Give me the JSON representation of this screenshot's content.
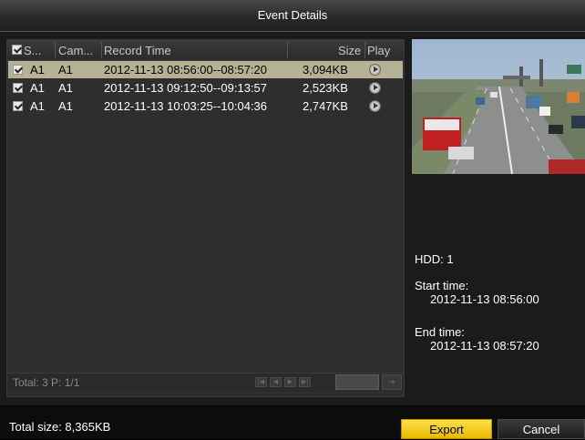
{
  "window": {
    "title": "Event Details"
  },
  "table": {
    "headers": {
      "select": "S...",
      "camera": "Cam...",
      "record_time": "Record Time",
      "size": "Size",
      "play": "Play"
    },
    "rows": [
      {
        "selected": true,
        "checked": true,
        "s": "A1",
        "camera": "A1",
        "record_time": "2012-11-13 08:56:00--08:57:20",
        "size": "3,094KB"
      },
      {
        "selected": false,
        "checked": true,
        "s": "A1",
        "camera": "A1",
        "record_time": "2012-11-13 09:12:50--09:13:57",
        "size": "2,523KB"
      },
      {
        "selected": false,
        "checked": true,
        "s": "A1",
        "camera": "A1",
        "record_time": "2012-11-13 10:03:25--10:04:36",
        "size": "2,747KB"
      }
    ],
    "footer": {
      "total": "Total: 3  P: 1/1"
    }
  },
  "details": {
    "hdd": "HDD: 1",
    "start_label": "Start time:",
    "start_value": "2012-11-13 08:56:00",
    "end_label": "End time:",
    "end_value": "2012-11-13 08:57:20"
  },
  "bottom": {
    "total_size": "Total size: 8,365KB",
    "export_label": "Export",
    "cancel_label": "Cancel"
  },
  "icons": [
    "checkbox-icon",
    "play-icon",
    "first-page-icon",
    "prev-page-icon",
    "next-page-icon",
    "last-page-icon",
    "go-icon"
  ],
  "colors": {
    "selected_row": "#b5b193",
    "export_button": "#f2cc1c",
    "background": "#1b1b1b"
  }
}
